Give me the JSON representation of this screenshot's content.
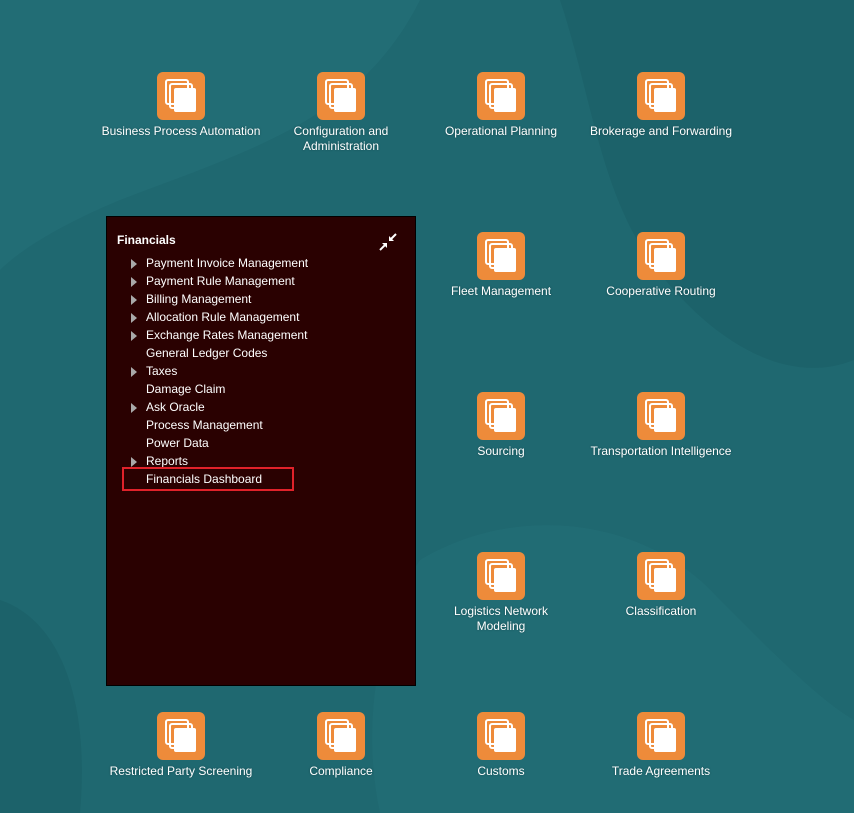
{
  "colors": {
    "background": "#1f6870",
    "tile_icon": "#ee8b3a",
    "panel_bg": "#2a0101",
    "highlight": "#e0222a"
  },
  "tiles": [
    {
      "label": "Business Process Automation"
    },
    {
      "label": "Configuration and Administration"
    },
    {
      "label": "Operational Planning"
    },
    {
      "label": "Brokerage and Forwarding"
    },
    {
      "label": "Fleet Management"
    },
    {
      "label": "Cooperative Routing"
    },
    {
      "label": "Sourcing"
    },
    {
      "label": "Transportation Intelligence"
    },
    {
      "label": "Logistics Network Modeling"
    },
    {
      "label": "Classification"
    },
    {
      "label": "Restricted Party Screening"
    },
    {
      "label": "Compliance"
    },
    {
      "label": "Customs"
    },
    {
      "label": "Trade Agreements"
    }
  ],
  "panel": {
    "title": "Financials",
    "collapse_icon": "collapse-arrows-icon",
    "items": [
      {
        "label": "Payment Invoice Management",
        "expandable": true
      },
      {
        "label": "Payment Rule Management",
        "expandable": true
      },
      {
        "label": "Billing Management",
        "expandable": true
      },
      {
        "label": "Allocation Rule Management",
        "expandable": true
      },
      {
        "label": "Exchange Rates Management",
        "expandable": true
      },
      {
        "label": "General Ledger Codes",
        "expandable": false
      },
      {
        "label": "Taxes",
        "expandable": true
      },
      {
        "label": "Damage Claim",
        "expandable": false
      },
      {
        "label": "Ask Oracle",
        "expandable": true
      },
      {
        "label": "Process Management",
        "expandable": false
      },
      {
        "label": "Power Data",
        "expandable": false
      },
      {
        "label": "Reports",
        "expandable": true
      },
      {
        "label": "Financials Dashboard",
        "expandable": false,
        "highlighted": true
      }
    ]
  }
}
